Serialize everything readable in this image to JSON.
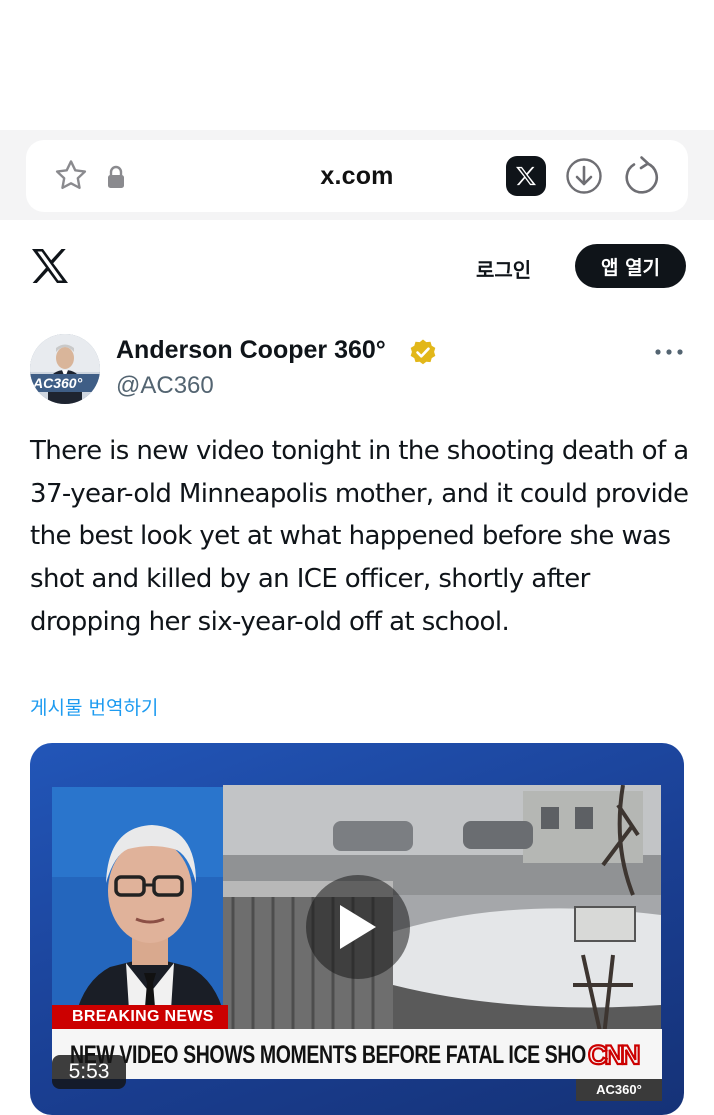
{
  "browser": {
    "url": "x.com",
    "icons": [
      "star-icon",
      "lock-icon",
      "x-app-icon",
      "download-icon",
      "reload-icon"
    ]
  },
  "header": {
    "logo": "x-logo-icon",
    "login_label": "로그인",
    "open_app_label": "앱 열기"
  },
  "post": {
    "author_name": "Anderson Cooper 360°",
    "handle": "@AC360",
    "avatar_text": "AC360°",
    "verified_color": "#e2b719",
    "text": "There is new video tonight in the shooting death of a 37-year-old Minneapolis mother, and it could provide the best look yet at what happened before she was shot and killed by an ICE officer, shortly after dropping her six-year-old off at school.",
    "translate_label": "게시물 번역하기"
  },
  "media": {
    "breaking_label": "BREAKING NEWS",
    "headline": "NEW VIDEO SHOWS MOMENTS BEFORE FATAL ICE SHOOTING",
    "network_logo": "CNN",
    "show_tag": "AC360°",
    "duration": "5:53"
  },
  "colors": {
    "accent_link": "#1d9bf0",
    "text_primary": "#0f1419",
    "text_secondary": "#536471",
    "breaking_red": "#cc0000",
    "card_blue": "#1f4fa8"
  }
}
